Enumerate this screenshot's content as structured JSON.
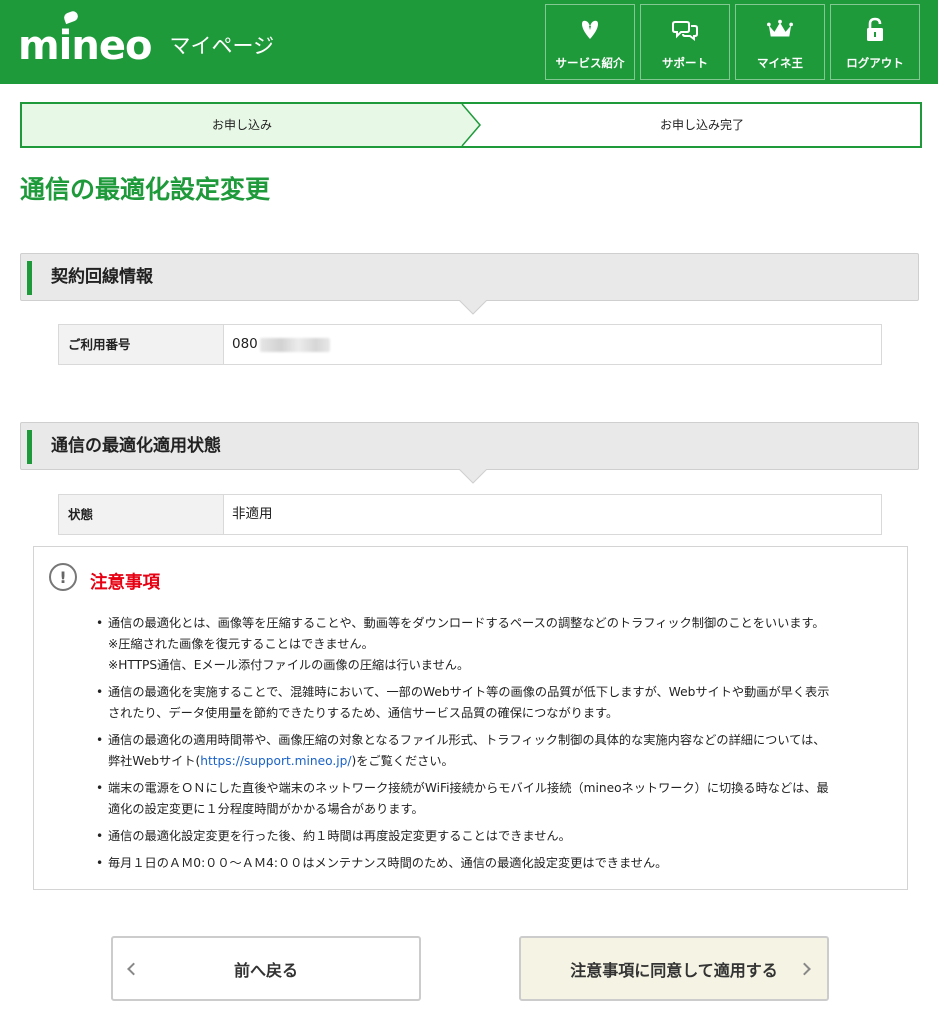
{
  "header": {
    "logo": "mineo",
    "subtitle": "マイページ",
    "nav": [
      {
        "label": "サービス紹介",
        "icon": "heart-leaf-icon"
      },
      {
        "label": "サポート",
        "icon": "chat-bubbles-icon"
      },
      {
        "label": "マイネ王",
        "icon": "crown-icon"
      },
      {
        "label": "ログアウト",
        "icon": "unlock-icon"
      }
    ]
  },
  "steps": {
    "step1": "お申し込み",
    "step2": "お申し込み完了",
    "current": 1
  },
  "page_title": "通信の最適化設定変更",
  "contract": {
    "heading": "契約回線情報",
    "label": "ご利用番号",
    "value": "080"
  },
  "status": {
    "heading": "通信の最適化適用状態",
    "label": "状態",
    "value": "非適用"
  },
  "notice": {
    "title": "注意事項",
    "items": [
      {
        "line1": "通信の最適化とは、画像等を圧縮することや、動画等をダウンロードするペースの調整などのトラフィック制御のことをいいます。",
        "line2": "※圧縮された画像を復元することはできません。",
        "line3": "※HTTPS通信、Eメール添付ファイルの画像の圧縮は行いません。"
      },
      {
        "line1": "通信の最適化を実施することで、混雑時において、一部のWebサイト等の画像の品質が低下しますが、Webサイトや動画が早く表示",
        "line2": "されたり、データ使用量を節約できたりするため、通信サービス品質の確保につながります。"
      },
      {
        "line1": "通信の最適化の適用時間帯や、画像圧縮の対象となるファイル形式、トラフィック制御の具体的な実施内容などの詳細については、",
        "line2_before": "弊社Webサイト(",
        "link": "https://support.mineo.jp/",
        "line2_after": ")をご覧ください。"
      },
      {
        "line1": "端末の電源をＯＮにした直後や端末のネットワーク接続がWiFi接続からモバイル接続（mineoネットワーク）に切換る時などは、最",
        "line2": "適化の設定変更に１分程度時間がかかる場合があります。"
      },
      {
        "line1": "通信の最適化設定変更を行った後、約１時間は再度設定変更することはできません。"
      },
      {
        "line1": "毎月１日のＡＭ0:００〜ＡＭ4:００はメンテナンス時間のため、通信の最適化設定変更はできません。"
      }
    ]
  },
  "buttons": {
    "back": "前へ戻る",
    "agree": "注意事項に同意して適用する"
  },
  "colors": {
    "brand_green": "#1e9a3b",
    "step_active_bg": "#e8f8e6",
    "warning_red": "#e60012",
    "link_blue": "#1a62c7",
    "agree_bg": "#f5f4e4"
  }
}
